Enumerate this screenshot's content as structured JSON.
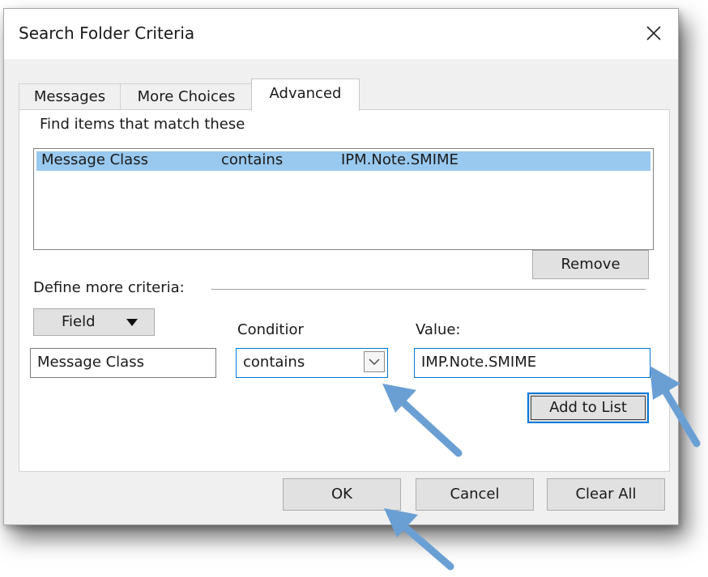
{
  "dialog": {
    "title": "Search Folder Criteria",
    "close_icon": "close-icon"
  },
  "tabs": [
    {
      "label": "Messages"
    },
    {
      "label": "More Choices"
    },
    {
      "label": "Advanced",
      "active": true
    }
  ],
  "criteria_list": {
    "label": "Find items that match these",
    "rows": [
      {
        "field": "Message Class",
        "condition": "contains",
        "value": "IPM.Note.SMIME",
        "selected": true
      }
    ]
  },
  "buttons": {
    "remove": "Remove",
    "field": "Field",
    "add_to_list": "Add to List",
    "ok": "OK",
    "cancel": "Cancel",
    "clear_all": "Clear All"
  },
  "define_more": {
    "label": "Define more criteria:",
    "condition_label": "Conditior",
    "value_label": "Value:",
    "field_value": "Message Class",
    "condition_value": "contains",
    "value_value": "IMP.Note.SMIME"
  },
  "colors": {
    "selection": "#99c9ef",
    "accent": "#0078d7",
    "annotation_arrow": "#6a9fd4"
  },
  "annotations": [
    "arrow-icon",
    "arrow-icon",
    "arrow-icon"
  ]
}
